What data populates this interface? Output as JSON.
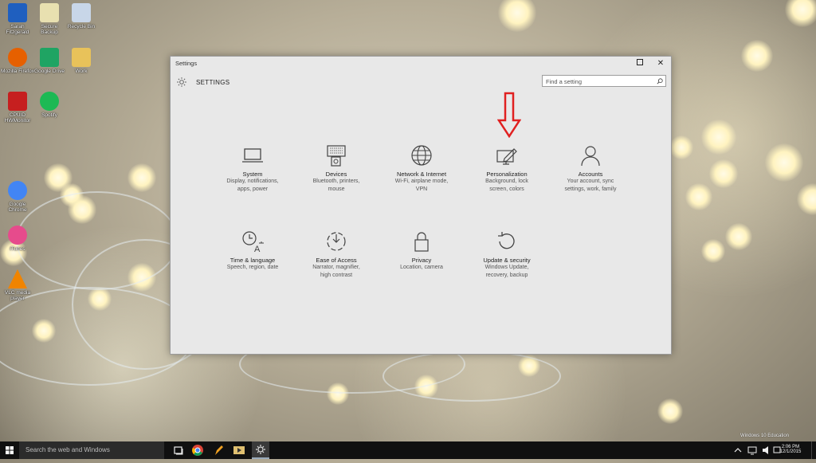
{
  "desktop": {
    "icons": [
      {
        "label": "Sarah Fitzgerald",
        "icon": "user-folder-icon",
        "color": "#1f5fbf"
      },
      {
        "label": "Secure Backup",
        "icon": "document-icon",
        "color": "#e8e0b0"
      },
      {
        "label": "Recycle Bin",
        "icon": "recycle-bin-icon",
        "color": "#c8d6e8"
      },
      {
        "label": "Mozilla Firefox",
        "icon": "firefox-icon",
        "color": "#e66000"
      },
      {
        "label": "Google Drive",
        "icon": "google-drive-icon",
        "color": "#1fa463"
      },
      {
        "label": "Work",
        "icon": "folder-icon",
        "color": "#e8c25a"
      },
      {
        "label": "CPUID HWMonitor",
        "icon": "hwmonitor-icon",
        "color": "#c61f1f"
      },
      {
        "label": "Spotify",
        "icon": "spotify-icon",
        "color": "#1db954"
      },
      {
        "label": "Google Chrome",
        "icon": "chrome-icon",
        "color": "#4285f4"
      },
      {
        "label": "iTunes",
        "icon": "itunes-icon",
        "color": "#e64b8c"
      },
      {
        "label": "VLC media player",
        "icon": "vlc-icon",
        "color": "#f08400"
      }
    ]
  },
  "window": {
    "title": "Settings",
    "minimize_glyph": "—",
    "close_glyph": "✕",
    "header_title": "SETTINGS",
    "search_placeholder": "Find a setting"
  },
  "tiles": [
    {
      "name": "System",
      "desc": [
        "Display, notifications,",
        "apps, power"
      ],
      "icon": "laptop-icon"
    },
    {
      "name": "Devices",
      "desc": [
        "Bluetooth, printers,",
        "mouse"
      ],
      "icon": "devices-icon"
    },
    {
      "name": "Network & Internet",
      "desc": [
        "Wi-Fi, airplane mode,",
        "VPN"
      ],
      "icon": "globe-icon"
    },
    {
      "name": "Personalization",
      "desc": [
        "Background, lock",
        "screen, colors"
      ],
      "icon": "personalization-icon"
    },
    {
      "name": "Accounts",
      "desc": [
        "Your account, sync",
        "settings, work, family"
      ],
      "icon": "person-icon"
    },
    {
      "name": "Time & language",
      "desc": [
        "Speech, region, date",
        ""
      ],
      "icon": "time-language-icon"
    },
    {
      "name": "Ease of Access",
      "desc": [
        "Narrator, magnifier,",
        "high contrast"
      ],
      "icon": "ease-of-access-icon"
    },
    {
      "name": "Privacy",
      "desc": [
        "Location, camera",
        ""
      ],
      "icon": "lock-icon"
    },
    {
      "name": "Update & security",
      "desc": [
        "Windows Update,",
        "recovery, backup"
      ],
      "icon": "update-icon"
    }
  ],
  "annotation": {
    "color": "#e02020",
    "icon": "red-arrow-icon"
  },
  "taskbar": {
    "search_placeholder": "Search the web and Windows",
    "time": "2:06 PM",
    "date": "12/1/2015",
    "watermark_line1": "Windows 10 Education",
    "watermark_line2": ""
  }
}
